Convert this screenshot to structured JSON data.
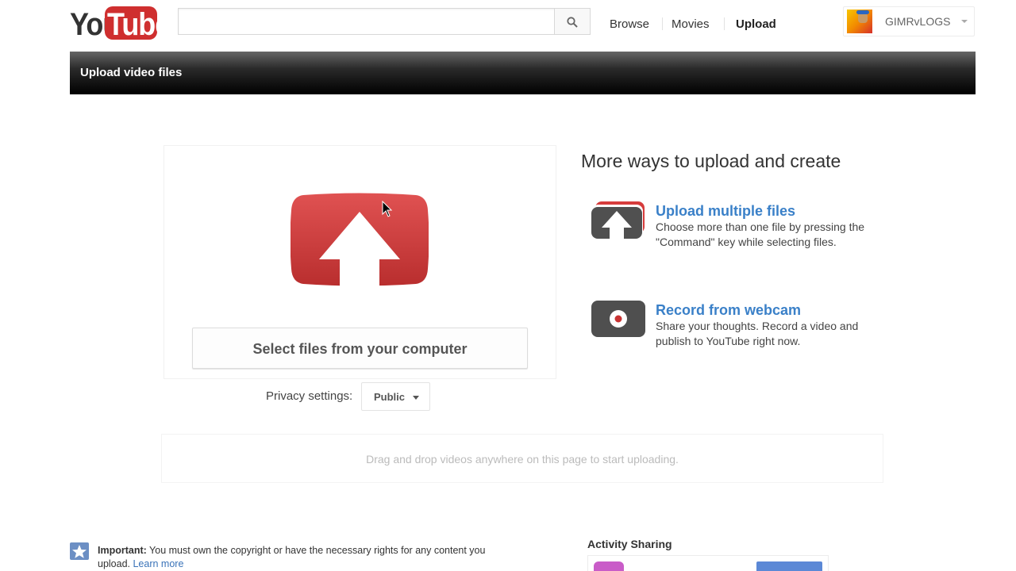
{
  "header": {
    "logo_you": "You",
    "logo_tube": "Tube",
    "search": {
      "value": "",
      "placeholder": ""
    },
    "nav": [
      "Browse",
      "Movies",
      "Upload"
    ],
    "username": "GIMRvLOGS"
  },
  "upload_bar": {
    "title": "Upload video files"
  },
  "upload": {
    "select_button": "Select files from your computer",
    "privacy_label": "Privacy settings:",
    "privacy_value": "Public",
    "dropzone_text": "Drag and drop videos anywhere on this page to start uploading."
  },
  "more_ways": {
    "title": "More ways to upload and create",
    "options": [
      {
        "title": "Upload multiple files",
        "description": "Choose more than one file by pressing the \"Command\" key while selecting files.",
        "icon": "upload-multiple-icon"
      },
      {
        "title": "Record from webcam",
        "description": "Share your thoughts. Record a video and publish to YouTube right now.",
        "icon": "webcam-icon"
      }
    ]
  },
  "footer": {
    "important_label": "Important:",
    "important_text": " You must own the copyright or have the necessary rights for any content you upload. ",
    "learn_more": "Learn more",
    "activity_title": "Activity Sharing"
  },
  "colors": {
    "brand_red": "#cf2f2f",
    "link_blue": "#3a80c8",
    "bar_black": "#000000"
  }
}
